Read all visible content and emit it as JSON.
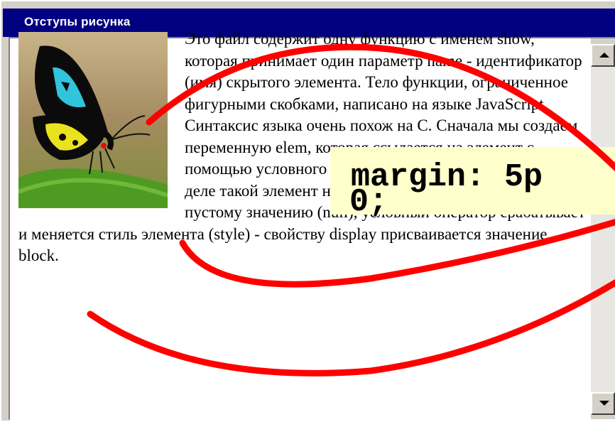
{
  "window": {
    "title": "Отступы рисунка"
  },
  "content": {
    "text_before": "Это файл содержит одну функцию с именем show, которая принимает один параметр name - идентификатор (имя) скрытого элемента. Тело функции, ограниченное фигурными скобками, написано на языке JavaScript. Синтаксис языка очень похож на C. Сначала мы создаем переменную elem, которая ссылается на элемент с помощью условного оператора проверяем, в самом ли деле такой элемент найден. Если значение elem не равно пустому значению (null), условный оператор срабатывает и меняется стиль элемента (style) - свойству display присваивается значение block.",
    "image_icon": "butterfly-image"
  },
  "callout": {
    "line1": "margin: 5p",
    "line2": "0;"
  },
  "colors": {
    "titlebar": "#000080",
    "callout_bg": "#ffffcc",
    "annotation_red": "#ff0000"
  }
}
